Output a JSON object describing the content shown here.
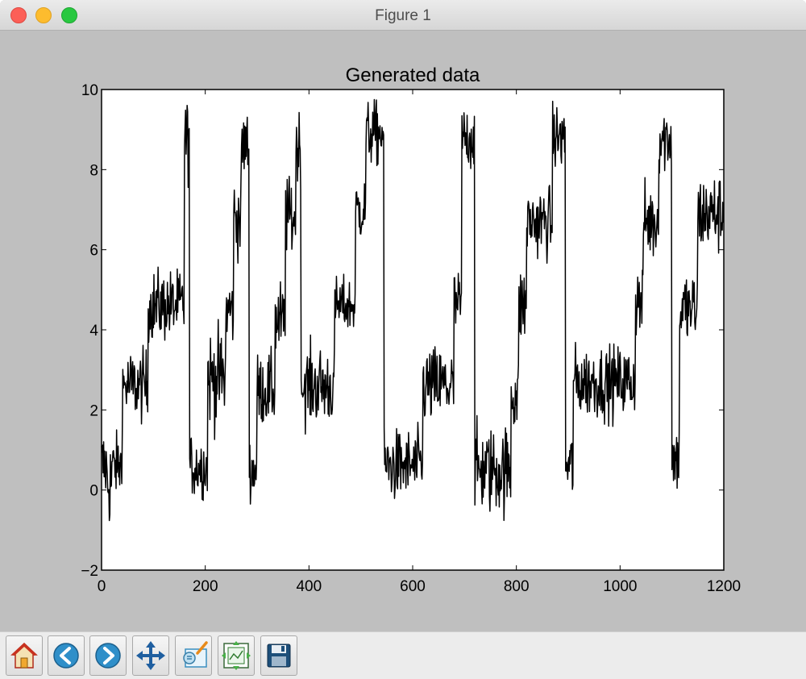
{
  "window": {
    "title": "Figure 1"
  },
  "toolbar": {
    "buttons": [
      {
        "name": "home-button",
        "icon": "home-icon"
      },
      {
        "name": "back-button",
        "icon": "back-arrow-icon"
      },
      {
        "name": "forward-button",
        "icon": "forward-arrow-icon"
      },
      {
        "name": "pan-button",
        "icon": "move-icon"
      },
      {
        "name": "zoom-button",
        "icon": "zoom-rectangle-icon"
      },
      {
        "name": "subplots-button",
        "icon": "subplots-icon"
      },
      {
        "name": "save-button",
        "icon": "save-icon"
      }
    ]
  },
  "chart_data": {
    "type": "line",
    "title": "Generated data",
    "xlabel": "",
    "ylabel": "",
    "xlim": [
      0,
      1200
    ],
    "ylim": [
      -2,
      10
    ],
    "xticks": [
      0,
      200,
      400,
      600,
      800,
      1000,
      1200
    ],
    "yticks": [
      -2,
      0,
      2,
      4,
      6,
      8,
      10
    ],
    "grid": false,
    "color": "#000000",
    "segments": [
      {
        "x": [
          0,
          10
        ],
        "level": 0.6,
        "noise": 0.5
      },
      {
        "x": [
          10,
          20
        ],
        "level": 0.2,
        "noise": 0.6
      },
      {
        "x": [
          20,
          40
        ],
        "level": 0.6,
        "noise": 0.4
      },
      {
        "x": [
          40,
          90
        ],
        "level": 2.6,
        "noise": 0.45
      },
      {
        "x": [
          90,
          160
        ],
        "level": 4.6,
        "noise": 0.45
      },
      {
        "x": [
          160,
          170
        ],
        "level": 8.8,
        "noise": 0.5
      },
      {
        "x": [
          170,
          205
        ],
        "level": 0.6,
        "noise": 0.4
      },
      {
        "x": [
          205,
          240
        ],
        "level": 2.8,
        "noise": 0.6
      },
      {
        "x": [
          240,
          255
        ],
        "level": 4.5,
        "noise": 0.45
      },
      {
        "x": [
          255,
          270
        ],
        "level": 6.8,
        "noise": 0.5
      },
      {
        "x": [
          270,
          285
        ],
        "level": 8.6,
        "noise": 0.45
      },
      {
        "x": [
          285,
          300
        ],
        "level": 0.5,
        "noise": 0.4
      },
      {
        "x": [
          300,
          335
        ],
        "level": 2.5,
        "noise": 0.45
      },
      {
        "x": [
          335,
          355
        ],
        "level": 4.2,
        "noise": 0.5
      },
      {
        "x": [
          355,
          375
        ],
        "level": 6.8,
        "noise": 0.5
      },
      {
        "x": [
          375,
          385
        ],
        "level": 8.6,
        "noise": 0.45
      },
      {
        "x": [
          385,
          450
        ],
        "level": 2.6,
        "noise": 0.5
      },
      {
        "x": [
          450,
          490
        ],
        "level": 4.6,
        "noise": 0.35
      },
      {
        "x": [
          490,
          510
        ],
        "level": 7.0,
        "noise": 0.4
      },
      {
        "x": [
          510,
          545
        ],
        "level": 8.9,
        "noise": 0.4
      },
      {
        "x": [
          545,
          620
        ],
        "level": 0.6,
        "noise": 0.45
      },
      {
        "x": [
          620,
          680
        ],
        "level": 2.6,
        "noise": 0.5
      },
      {
        "x": [
          680,
          695
        ],
        "level": 4.6,
        "noise": 0.45
      },
      {
        "x": [
          695,
          720
        ],
        "level": 8.8,
        "noise": 0.4
      },
      {
        "x": [
          720,
          790
        ],
        "level": 0.5,
        "noise": 0.55
      },
      {
        "x": [
          790,
          805
        ],
        "level": 2.4,
        "noise": 0.5
      },
      {
        "x": [
          805,
          820
        ],
        "level": 4.6,
        "noise": 0.5
      },
      {
        "x": [
          820,
          870
        ],
        "level": 6.7,
        "noise": 0.45
      },
      {
        "x": [
          870,
          895
        ],
        "level": 8.8,
        "noise": 0.4
      },
      {
        "x": [
          895,
          910
        ],
        "level": 0.6,
        "noise": 0.45
      },
      {
        "x": [
          910,
          1030
        ],
        "level": 2.7,
        "noise": 0.45
      },
      {
        "x": [
          1030,
          1045
        ],
        "level": 4.7,
        "noise": 0.45
      },
      {
        "x": [
          1045,
          1075
        ],
        "level": 6.7,
        "noise": 0.5
      },
      {
        "x": [
          1075,
          1100
        ],
        "level": 8.8,
        "noise": 0.45
      },
      {
        "x": [
          1100,
          1115
        ],
        "level": 0.8,
        "noise": 0.45
      },
      {
        "x": [
          1115,
          1150
        ],
        "level": 4.5,
        "noise": 0.5
      },
      {
        "x": [
          1150,
          1200
        ],
        "level": 6.9,
        "noise": 0.5
      }
    ]
  }
}
